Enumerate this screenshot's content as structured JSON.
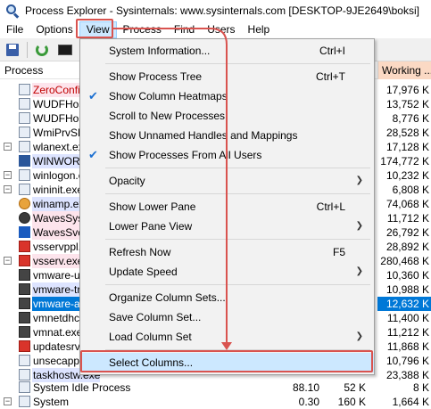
{
  "window": {
    "title": "Process Explorer - Sysinternals: www.sysinternals.com [DESKTOP-9JE2649\\boksi]"
  },
  "menubar": {
    "items": [
      {
        "label": "File"
      },
      {
        "label": "Options"
      },
      {
        "label": "View"
      },
      {
        "label": "Process"
      },
      {
        "label": "Find"
      },
      {
        "label": "Users"
      },
      {
        "label": "Help"
      }
    ]
  },
  "toolbar": {
    "icons": [
      "save-icon",
      "refresh-icon",
      "system-info-icon"
    ]
  },
  "columns": {
    "process": "Process",
    "working_set": "Working ..."
  },
  "processes": [
    {
      "name": "ZeroConfig",
      "working_set": "17,976 K"
    },
    {
      "name": "WUDFHos",
      "working_set": "13,752 K"
    },
    {
      "name": "WUDFHos",
      "working_set": "8,776 K"
    },
    {
      "name": "WmiPrvSE",
      "working_set": "28,528 K"
    },
    {
      "name": "wlanext.exe",
      "working_set": "17,128 K"
    },
    {
      "name": "WINWORD",
      "working_set": "174,772 K"
    },
    {
      "name": "winlogon.e",
      "working_set": "10,232 K"
    },
    {
      "name": "wininit.exe",
      "working_set": "6,808 K"
    },
    {
      "name": "winamp.exe",
      "working_set": "74,068 K"
    },
    {
      "name": "WavesSys",
      "working_set": "11,712 K"
    },
    {
      "name": "WavesSvc",
      "working_set": "26,792 K"
    },
    {
      "name": "vsservppl.e",
      "working_set": "28,892 K"
    },
    {
      "name": "vsserv.exe",
      "working_set": "280,468 K"
    },
    {
      "name": "vmware-us",
      "working_set": "10,360 K"
    },
    {
      "name": "vmware-tra",
      "working_set": "10,988 K"
    },
    {
      "name": "vmware-au",
      "working_set": "12,632 K"
    },
    {
      "name": "vmnetdhcp",
      "working_set": "11,400 K"
    },
    {
      "name": "vmnat.exe",
      "working_set": "11,212 K"
    },
    {
      "name": "updatesrv.e",
      "working_set": "11,868 K"
    },
    {
      "name": "unsecapp.e",
      "working_set": "10,796 K"
    },
    {
      "name": "taskhostw.exe",
      "working_set": "23,388 K"
    },
    {
      "name": "System Idle Process",
      "cpu": "88.10",
      "private_bytes": "52 K",
      "working_set": "8 K"
    },
    {
      "name": "System",
      "cpu": "0.30",
      "private_bytes": "160 K",
      "working_set": "1,664 K"
    }
  ],
  "view_menu": {
    "items": [
      {
        "label": "System Information...",
        "shortcut": "Ctrl+I"
      },
      {
        "label": "Show Process Tree",
        "shortcut": "Ctrl+T"
      },
      {
        "label": "Show Column Heatmaps",
        "checked": true
      },
      {
        "label": "Scroll to New Processes"
      },
      {
        "label": "Show Unnamed Handles and Mappings"
      },
      {
        "label": "Show Processes From All Users",
        "checked": true
      },
      {
        "label": "Opacity",
        "submenu": true
      },
      {
        "label": "Show Lower Pane",
        "shortcut": "Ctrl+L"
      },
      {
        "label": "Lower Pane View",
        "submenu": true
      },
      {
        "label": "Refresh Now",
        "shortcut": "F5"
      },
      {
        "label": "Update Speed",
        "submenu": true
      },
      {
        "label": "Organize Column Sets..."
      },
      {
        "label": "Save Column Set..."
      },
      {
        "label": "Load Column Set",
        "submenu": true
      },
      {
        "label": "Select Columns..."
      }
    ]
  },
  "colors": {
    "menu_hover": "#cce8ff",
    "annotation": "#d9534f",
    "working_set_heat": "#fbd9c4",
    "selected_row": "#0078d7",
    "service_row": "#fde4ec",
    "own_process_row": "#dde4ff"
  }
}
